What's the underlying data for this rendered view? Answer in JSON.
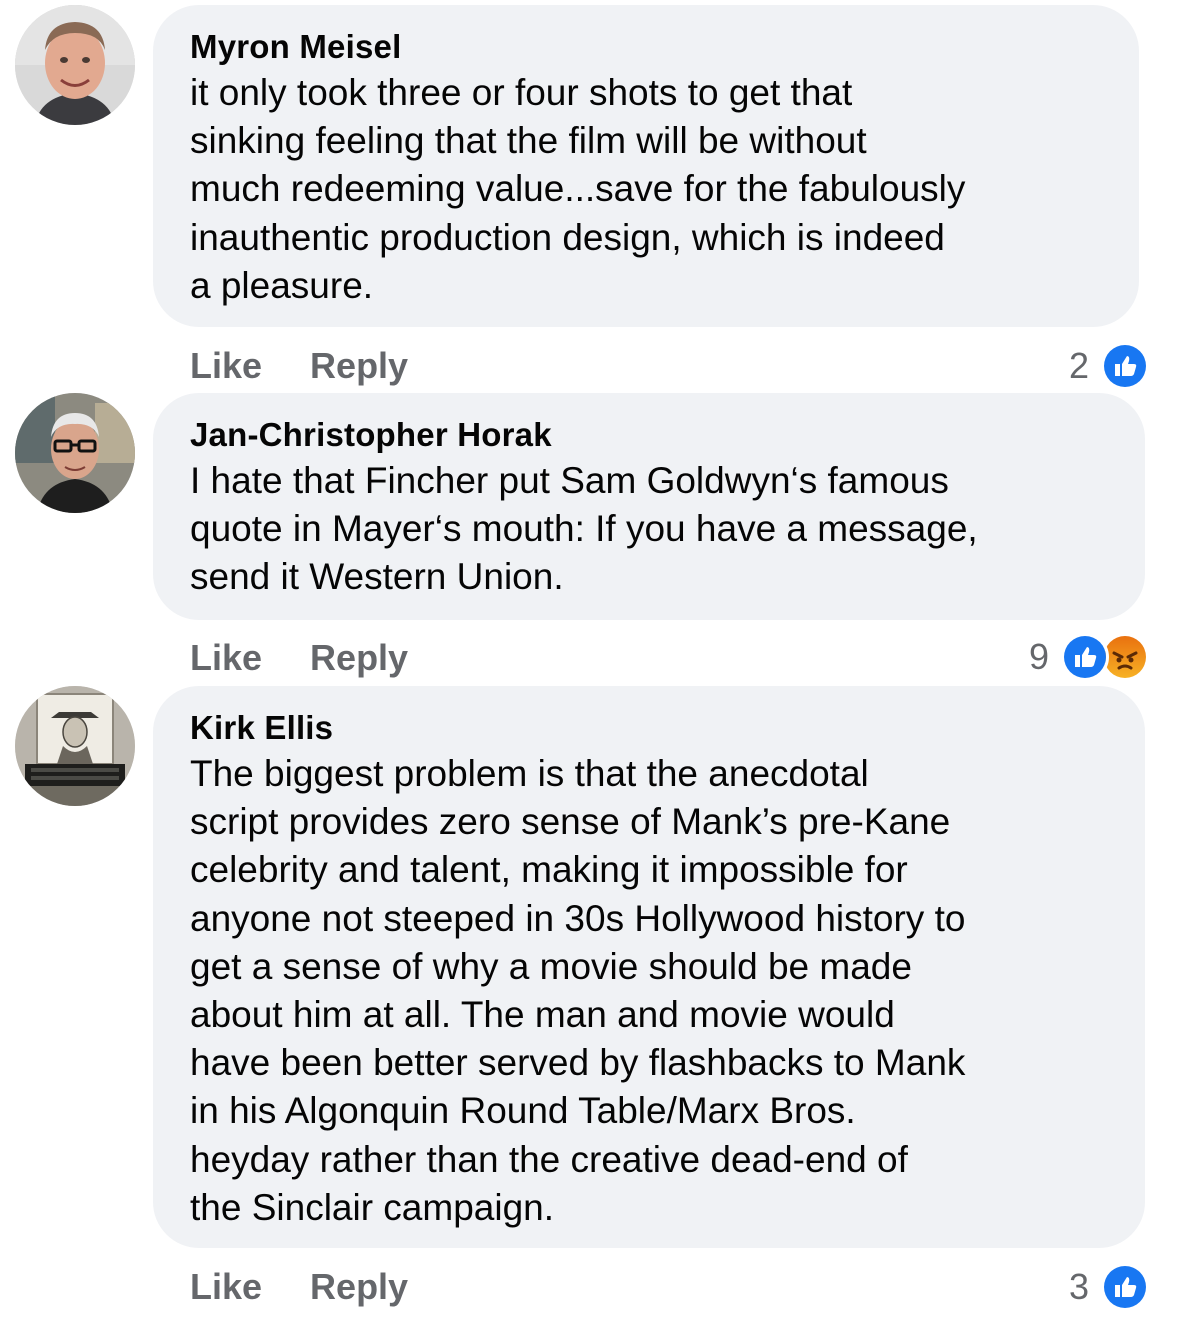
{
  "comments": [
    {
      "author": "Myron Meisel",
      "lines": [
        "it only took three or four shots to get that",
        "sinking feeling that the film will be without",
        "much redeeming value...save for the fabulously",
        "inauthentic production design, which is indeed",
        "a pleasure."
      ],
      "like_label": "Like",
      "reply_label": "Reply",
      "reaction_count": "2",
      "reactions": [
        "like-icon"
      ]
    },
    {
      "author": "Jan-Christopher Horak",
      "lines": [
        "I hate that Fincher put Sam Goldwyn‘s famous",
        "quote in Mayer‘s mouth: If you have a message,",
        "send it Western Union."
      ],
      "like_label": "Like",
      "reply_label": "Reply",
      "reaction_count": "9",
      "reactions": [
        "like-icon",
        "angry-icon"
      ]
    },
    {
      "author": "Kirk Ellis",
      "lines": [
        "The biggest problem is that the anecdotal",
        "script provides zero sense of Mank’s pre-Kane",
        "celebrity and talent, making it impossible for",
        "anyone not steeped in 30s Hollywood history to",
        "get a sense of why a movie should be made",
        "about him at all. The man and movie would",
        "have been better served by flashbacks to Mank",
        "in his Algonquin Round Table/Marx Bros.",
        "heyday rather than the creative dead-end of",
        "the Sinclair campaign."
      ],
      "like_label": "Like",
      "reply_label": "Reply",
      "reaction_count": "3",
      "reactions": [
        "like-icon"
      ]
    }
  ],
  "colors": {
    "bubble_bg": "#f0f2f5",
    "action_text": "#65676b",
    "like_blue": "#1877f2",
    "angry_orange": "#e9710f"
  }
}
